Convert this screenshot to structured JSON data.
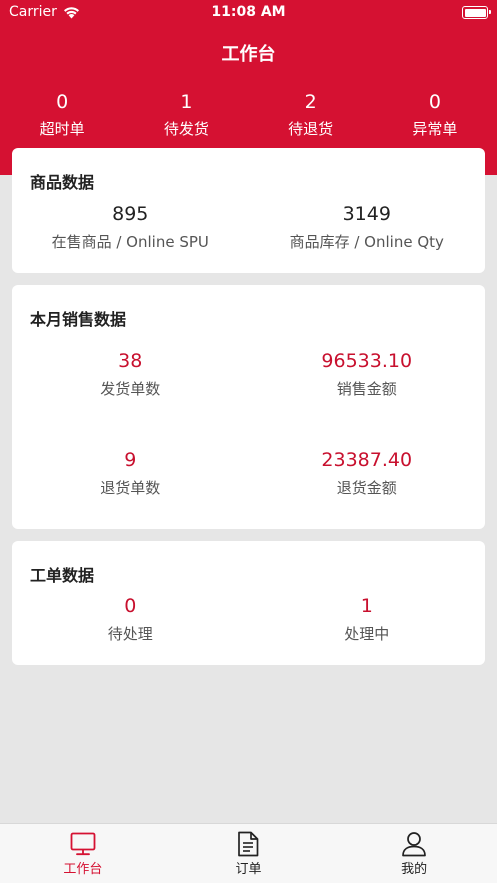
{
  "status_bar": {
    "carrier": "Carrier",
    "time": "11:08 AM"
  },
  "header": {
    "title": "工作台"
  },
  "top_stats": [
    {
      "value": "0",
      "label": "超时单"
    },
    {
      "value": "1",
      "label": "待发货"
    },
    {
      "value": "2",
      "label": "待退货"
    },
    {
      "value": "0",
      "label": "异常单"
    }
  ],
  "product_card": {
    "title": "商品数据",
    "items": [
      {
        "value": "895",
        "label": "在售商品 / Online SPU"
      },
      {
        "value": "3149",
        "label": "商品库存 / Online Qty"
      }
    ]
  },
  "sales_card": {
    "title": "本月销售数据",
    "items": [
      {
        "value": "38",
        "label": "发货单数"
      },
      {
        "value": "96533.10",
        "label": "销售金额"
      },
      {
        "value": "9",
        "label": "退货单数"
      },
      {
        "value": "23387.40",
        "label": "退货金额"
      }
    ]
  },
  "ticket_card": {
    "title": "工单数据",
    "items": [
      {
        "value": "0",
        "label": "待处理"
      },
      {
        "value": "1",
        "label": "处理中"
      }
    ]
  },
  "tabbar": {
    "items": [
      {
        "label": "工作台",
        "icon": "monitor-icon",
        "active": true
      },
      {
        "label": "订单",
        "icon": "document-icon",
        "active": false
      },
      {
        "label": "我的",
        "icon": "person-icon",
        "active": false
      }
    ]
  },
  "colors": {
    "brand": "#d51132",
    "value_red": "#c8102e",
    "background": "#e6e6e6"
  }
}
